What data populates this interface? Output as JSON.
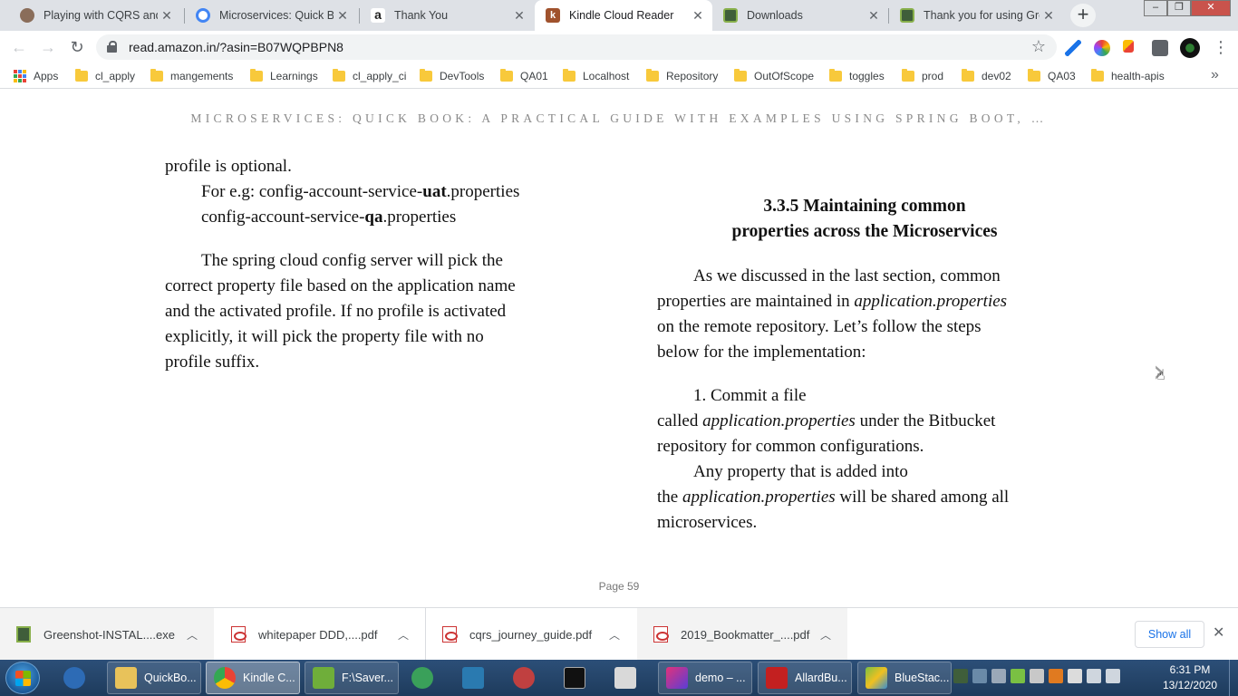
{
  "browser": {
    "tabs": [
      {
        "title": "Playing with CQRS and E",
        "favicon_color": "#8a6d5a",
        "active": false
      },
      {
        "title": "Microservices: Quick Boo",
        "favicon_color": "#4285f4",
        "active": false
      },
      {
        "title": "Thank You",
        "favicon_color": "#222222",
        "active": false
      },
      {
        "title": "Kindle Cloud Reader",
        "favicon_color": "#a0522d",
        "active": true
      },
      {
        "title": "Downloads",
        "favicon_color": "#3f5e3a",
        "active": false
      },
      {
        "title": "Thank you for using Gre",
        "favicon_color": "#3f5e3a",
        "active": false
      }
    ],
    "new_tab_label": "+",
    "url": "read.amazon.in/?asin=B07WQPBPN8",
    "bookmarks": [
      "Apps",
      "cl_apply",
      "mangements",
      "Learnings",
      "cl_apply_ci",
      "DevTools",
      "QA01",
      "Localhost",
      "Repository",
      "OutOfScope",
      "toggles",
      "prod",
      "dev02",
      "QA03",
      "health-apis"
    ],
    "bookmarks_overflow": "»"
  },
  "reader": {
    "book_title": "MICROSERVICES: QUICK BOOK: A PRACTICAL GUIDE WITH EXAMPLES USING SPRING BOOT, …",
    "left": {
      "line1": "profile is optional.",
      "eg_prefix": "For e.g:  config-account-service-",
      "eg_bold1": "uat",
      "eg_suffix1": ".properties",
      "eg2_prefix": "config-account-service-",
      "eg_bold2": "qa",
      "eg_suffix2": ".properties",
      "para": [
        "The spring cloud config server will pick the",
        "correct property file based on the application name",
        "and the activated profile. If no profile is activated",
        "explicitly, it will pick the property file with no",
        "profile suffix."
      ]
    },
    "right": {
      "heading_line1": "3.3.5 Maintaining common",
      "heading_line2": "properties across the Microservices",
      "p1_l1": "As we discussed in the last section, common",
      "p1_l2_pre": "properties are maintained in ",
      "p1_l2_it": "application.properties",
      "p1_l3": "on the remote repository. Let’s follow the steps",
      "p1_l4": "below for the implementation:",
      "step1_l1": "1. Commit a file",
      "step1_l2_pre": "called ",
      "step1_l2_it": "application.properties",
      "step1_l2_post": " under the Bitbucket",
      "step1_l3": "repository for common configurations.",
      "p2_l1": "Any property that is added into",
      "p2_l2_pre": "the ",
      "p2_l2_it": "application.properties",
      "p2_l2_post": " will be shared among all",
      "p2_l3": "microservices."
    },
    "next_arrow": "›",
    "page_label": "Page 59"
  },
  "downloads": {
    "items": [
      {
        "name": "Greenshot-INSTAL....exe",
        "type": "exe"
      },
      {
        "name": "whitepaper DDD,....pdf",
        "type": "pdf"
      },
      {
        "name": "cqrs_journey_guide.pdf",
        "type": "pdf"
      },
      {
        "name": "2019_Bookmatter_....pdf",
        "type": "pdf"
      }
    ],
    "show_all": "Show all",
    "close": "✕"
  },
  "taskbar": {
    "items": [
      {
        "label": "",
        "icon_color": "#2d6bb5"
      },
      {
        "label": "QuickBo...",
        "icon_color": "#e8c25a"
      },
      {
        "label": "Kindle C...",
        "icon_color": "#4285f4"
      },
      {
        "label": "F:\\Saver...",
        "icon_color": "#6fae3a"
      },
      {
        "label": "",
        "icon_color": "#3aa05a"
      },
      {
        "label": "",
        "icon_color": "#2a7ab0"
      },
      {
        "label": "",
        "icon_color": "#c04040"
      },
      {
        "label": "",
        "icon_color": "#111111"
      },
      {
        "label": "",
        "icon_color": "#d9d9d9"
      },
      {
        "label": "demo – ...",
        "icon_color": "#e2327a"
      },
      {
        "label": "AllardBu...",
        "icon_color": "#c32020"
      },
      {
        "label": "BlueStac...",
        "icon_color": "#7ac043"
      }
    ],
    "time": "6:31 PM",
    "date": "13/12/2020"
  }
}
